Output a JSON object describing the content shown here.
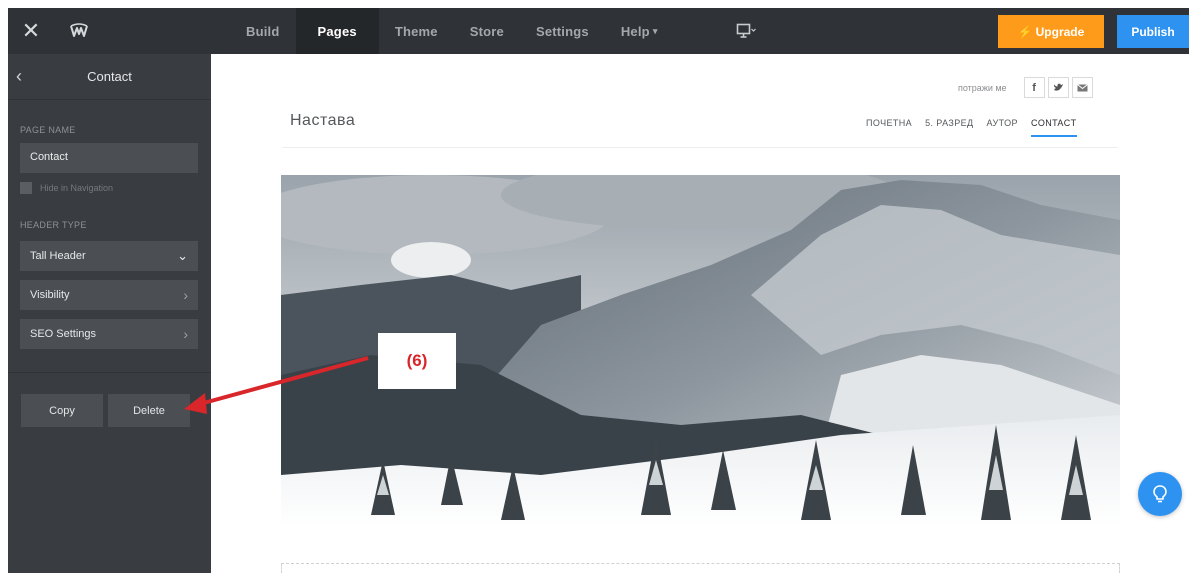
{
  "topbar": {
    "nav": [
      {
        "label": "Build",
        "active": false
      },
      {
        "label": "Pages",
        "active": true
      },
      {
        "label": "Theme",
        "active": false
      },
      {
        "label": "Store",
        "active": false
      },
      {
        "label": "Settings",
        "active": false
      },
      {
        "label": "Help",
        "active": false,
        "dropdown": true
      }
    ],
    "upgrade_label": "Upgrade",
    "publish_label": "Publish",
    "colors": {
      "bar": "#2f3236",
      "upgrade": "#ff9b1a",
      "publish": "#2e93f0"
    }
  },
  "sidebar": {
    "title": "Contact",
    "page_name_label": "PAGE NAME",
    "page_name_value": "Contact",
    "hide_nav_label": "Hide in Navigation",
    "header_type_label": "HEADER TYPE",
    "header_type_value": "Tall Header",
    "visibility_label": "Visibility",
    "seo_label": "SEO Settings",
    "copy_label": "Copy",
    "delete_label": "Delete"
  },
  "site": {
    "social_label": "потражи ме",
    "social_icons": [
      "f",
      "t",
      "m"
    ],
    "title": "Настава",
    "nav": [
      {
        "label": "ПОЧЕТНА",
        "active": false
      },
      {
        "label": "5. РАЗРЕД",
        "active": false
      },
      {
        "label": "АУТОР",
        "active": false
      },
      {
        "label": "CONTACT",
        "active": true
      }
    ]
  },
  "annotation": {
    "label": "(6)",
    "color": "#d8262a"
  }
}
